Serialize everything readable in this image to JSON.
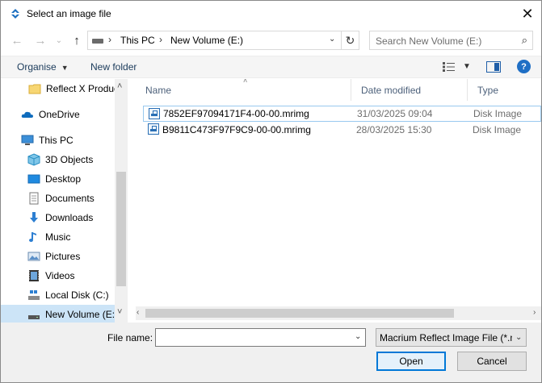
{
  "window": {
    "title": "Select an image file"
  },
  "address": {
    "crumbs": [
      "This PC",
      "New Volume (E:)"
    ]
  },
  "search": {
    "placeholder": "Search New Volume (E:)"
  },
  "toolbar": {
    "organise_label": "Organise",
    "new_folder_label": "New folder"
  },
  "nav_pane": {
    "items": [
      {
        "label": "Reflect X Produc",
        "icon": "folder-icon"
      },
      {
        "label": "OneDrive",
        "icon": "cloud-icon"
      },
      {
        "label": "This PC",
        "icon": "computer-icon"
      },
      {
        "label": "3D Objects",
        "icon": "cube-icon"
      },
      {
        "label": "Desktop",
        "icon": "desktop-icon"
      },
      {
        "label": "Documents",
        "icon": "document-icon"
      },
      {
        "label": "Downloads",
        "icon": "download-icon"
      },
      {
        "label": "Music",
        "icon": "music-icon"
      },
      {
        "label": "Pictures",
        "icon": "picture-icon"
      },
      {
        "label": "Videos",
        "icon": "video-icon"
      },
      {
        "label": "Local Disk (C:)",
        "icon": "drive-icon"
      },
      {
        "label": "New Volume (E:)",
        "icon": "drive-icon",
        "selected": true
      }
    ]
  },
  "file_list": {
    "columns": [
      "Name",
      "Date modified",
      "Type"
    ],
    "rows": [
      {
        "name": "7852EF97094171F4-00-00.mrimg",
        "date": "31/03/2025 09:04",
        "type": "Disk Image"
      },
      {
        "name": "B9811C473F97F9C9-00-00.mrimg",
        "date": "28/03/2025 15:30",
        "type": "Disk Image"
      }
    ]
  },
  "bottom": {
    "file_name_label": "File name:",
    "file_name_value": "",
    "filter_value": "Macrium Reflect Image File (*.mrimg)",
    "open_label": "Open",
    "cancel_label": "Cancel"
  },
  "colors": {
    "accent": "#0078d7",
    "selection": "#cce4f7",
    "link": "#1a3a5a"
  }
}
